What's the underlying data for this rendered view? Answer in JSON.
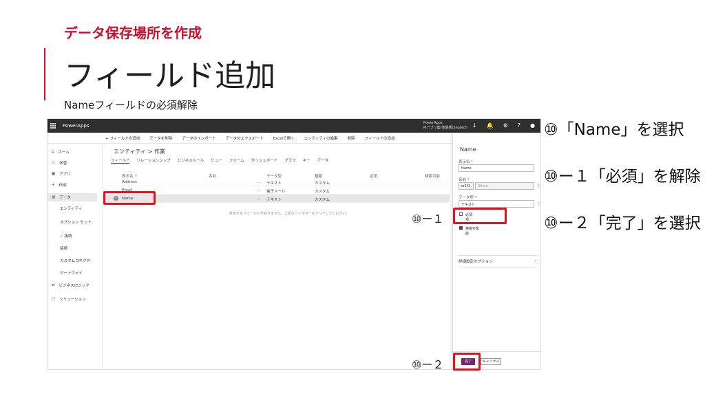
{
  "slide": {
    "subtitle": "データ保存場所を作成",
    "title": "フィールド追加",
    "caption": "Nameフィールドの必須解除"
  },
  "app": {
    "name": "PowerApps",
    "env_line1": "PowerApps",
    "env_line2": "PJアプリ集(体験版)Segtech",
    "top_icons": [
      "download-icon",
      "bell-icon",
      "gear-icon",
      "help-icon",
      "avatar"
    ]
  },
  "toolbar": [
    "← フィールドの追加",
    "データを削除",
    "データのインポート",
    "データのエクスポート",
    "Excelで開く",
    "エンティティの編集",
    "削除",
    "フィールドの追加"
  ],
  "sidebar": {
    "items": [
      {
        "icon": "⌂",
        "label": "ホーム"
      },
      {
        "icon": "▭",
        "label": "学習"
      },
      {
        "icon": "▦",
        "label": "アプリ"
      },
      {
        "icon": "+",
        "label": "作成"
      },
      {
        "icon": "▤",
        "label": "データ"
      }
    ],
    "sub_items": [
      "エンティティ",
      "オプション セット",
      "✓ 接続",
      "接続",
      "カスタムコネクタ",
      "ゲートウェイ"
    ],
    "bottom_items": [
      {
        "icon": "⇄",
        "label": "ビジネスロジック"
      },
      {
        "icon": "▢",
        "label": "ソリューション"
      }
    ]
  },
  "entity": {
    "title": "エンティティ > 作業",
    "tabs": [
      "フィールド",
      "リレーションシップ",
      "ビジネスルール",
      "ビュー",
      "フォーム",
      "ダッシュボード",
      "グラフ",
      "キー",
      "データ"
    ],
    "columns": [
      "表示名 ↑",
      "名前",
      "データ型",
      "種類",
      "必須",
      "検索可能"
    ],
    "rows": [
      {
        "display": "Address",
        "name": "…",
        "type": "テキスト",
        "kind": "カスタム"
      },
      {
        "display": "Email",
        "name": "…",
        "type": "電子メール",
        "kind": "カスタム"
      },
      {
        "display": "Name",
        "name": "…",
        "type": "テキスト",
        "kind": "カスタム"
      }
    ],
    "note": "表示するフィールドがありません。上記のフィルターをクリアしてください。"
  },
  "panel": {
    "title": "Name",
    "display_label": "表示名 *",
    "display_value": "Name",
    "name_label": "名前 *",
    "prefix": "cr1f1_",
    "name_value": "Name",
    "type_label": "データ型 *",
    "type_value": "テキスト",
    "required_label": "必須",
    "required_sub": "項",
    "searchable_label": "検索可能",
    "searchable_sub": "能",
    "advanced_label": "詳細設定オプション",
    "done": "完了",
    "cancel": "キャンセル"
  },
  "callouts": {
    "c1": "⑩ー１",
    "c2": "⑩ー２"
  },
  "instructions": [
    "⑩「Name」を選択",
    "⑩ー１「必須」を解除",
    "⑩ー２「完了」を選択"
  ],
  "colors": {
    "accent": "#c8102e",
    "brand": "#742774",
    "highlight": "#e8101e"
  }
}
